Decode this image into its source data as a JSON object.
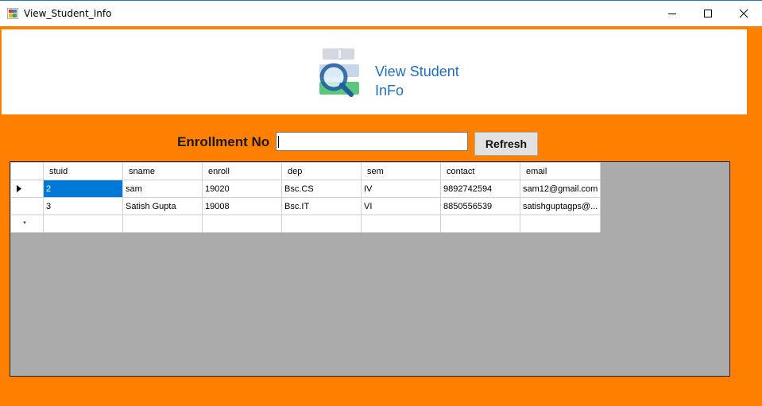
{
  "window": {
    "title": "View_Student_Info"
  },
  "header": {
    "title_line1": "View Student",
    "title_line2": "InFo"
  },
  "search": {
    "label": "Enrollment No",
    "value": "",
    "refresh_label": "Refresh"
  },
  "grid": {
    "columns": [
      "stuid",
      "sname",
      "enroll",
      "dep",
      "sem",
      "contact",
      "email"
    ],
    "rows": [
      [
        "2",
        "sam",
        "19020",
        "Bsc.CS",
        "IV",
        "9892742594",
        "sam12@gmail.com"
      ],
      [
        "3",
        "Satish Gupta",
        "19008",
        "Bsc.IT",
        "VI",
        "8850556539",
        "satishguptagps@..."
      ]
    ],
    "new_row_marker": "*"
  },
  "colors": {
    "background": "#ff8000",
    "header_title": "#1e6fc4",
    "selection": "#0078d7",
    "grid_empty": "#ababab"
  }
}
